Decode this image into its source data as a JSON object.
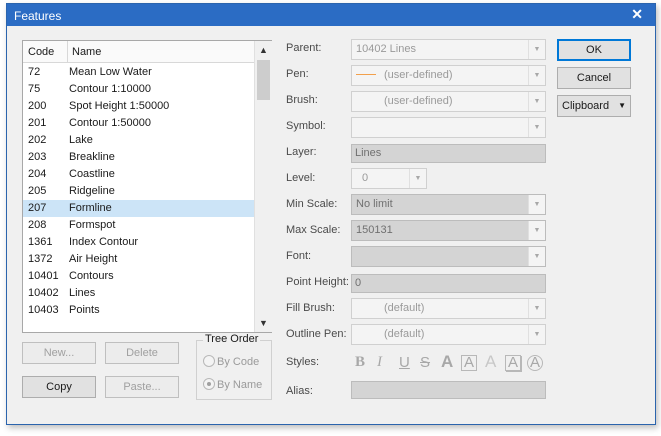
{
  "window": {
    "title": "Features",
    "close_glyph": "✕"
  },
  "list": {
    "headers": {
      "code": "Code",
      "name": "Name"
    },
    "rows": [
      {
        "code": "72",
        "name": "Mean Low Water"
      },
      {
        "code": "75",
        "name": "Contour 1:10000"
      },
      {
        "code": "200",
        "name": "Spot Height 1:50000"
      },
      {
        "code": "201",
        "name": "Contour 1:50000"
      },
      {
        "code": "202",
        "name": "Lake"
      },
      {
        "code": "203",
        "name": "Breakline"
      },
      {
        "code": "204",
        "name": "Coastline"
      },
      {
        "code": "205",
        "name": "Ridgeline"
      },
      {
        "code": "207",
        "name": "Formline"
      },
      {
        "code": "208",
        "name": "Formspot"
      },
      {
        "code": "1361",
        "name": "Index Contour"
      },
      {
        "code": "1372",
        "name": "Air Height"
      },
      {
        "code": "10401",
        "name": "Contours"
      },
      {
        "code": "10402",
        "name": "Lines"
      },
      {
        "code": "10403",
        "name": "Points"
      }
    ],
    "selected_code": "207"
  },
  "buttons": {
    "new": "New...",
    "delete": "Delete",
    "copy": "Copy",
    "paste": "Paste...",
    "ok": "OK",
    "cancel": "Cancel",
    "clipboard": "Clipboard"
  },
  "tree_order": {
    "legend": "Tree Order",
    "by_code": "By Code",
    "by_name": "By Name",
    "selected": "By Name"
  },
  "props": {
    "parent": {
      "label": "Parent:",
      "value": "10402 Lines"
    },
    "pen": {
      "label": "Pen:",
      "value": "(user-defined)"
    },
    "brush": {
      "label": "Brush:",
      "value": "(user-defined)"
    },
    "symbol": {
      "label": "Symbol:",
      "value": ""
    },
    "layer": {
      "label": "Layer:",
      "value": "Lines"
    },
    "level": {
      "label": "Level:",
      "value": "0"
    },
    "min_scale": {
      "label": "Min Scale:",
      "value": "No limit"
    },
    "max_scale": {
      "label": "Max Scale:",
      "value": "150131"
    },
    "font": {
      "label": "Font:",
      "value": ""
    },
    "point_height": {
      "label": "Point Height:",
      "value": "0"
    },
    "fill_brush": {
      "label": "Fill Brush:",
      "value": "(default)"
    },
    "outline_pen": {
      "label": "Outline Pen:",
      "value": "(default)"
    },
    "styles": {
      "label": "Styles:",
      "bold": "B",
      "italic": "I",
      "underline": "U",
      "strike": "S",
      "a": "A"
    },
    "alias": {
      "label": "Alias:",
      "value": ""
    }
  },
  "colors": {
    "title_bar": "#2b6cc4",
    "selection": "#cce4f7",
    "pen_line": "#f2a04c"
  }
}
